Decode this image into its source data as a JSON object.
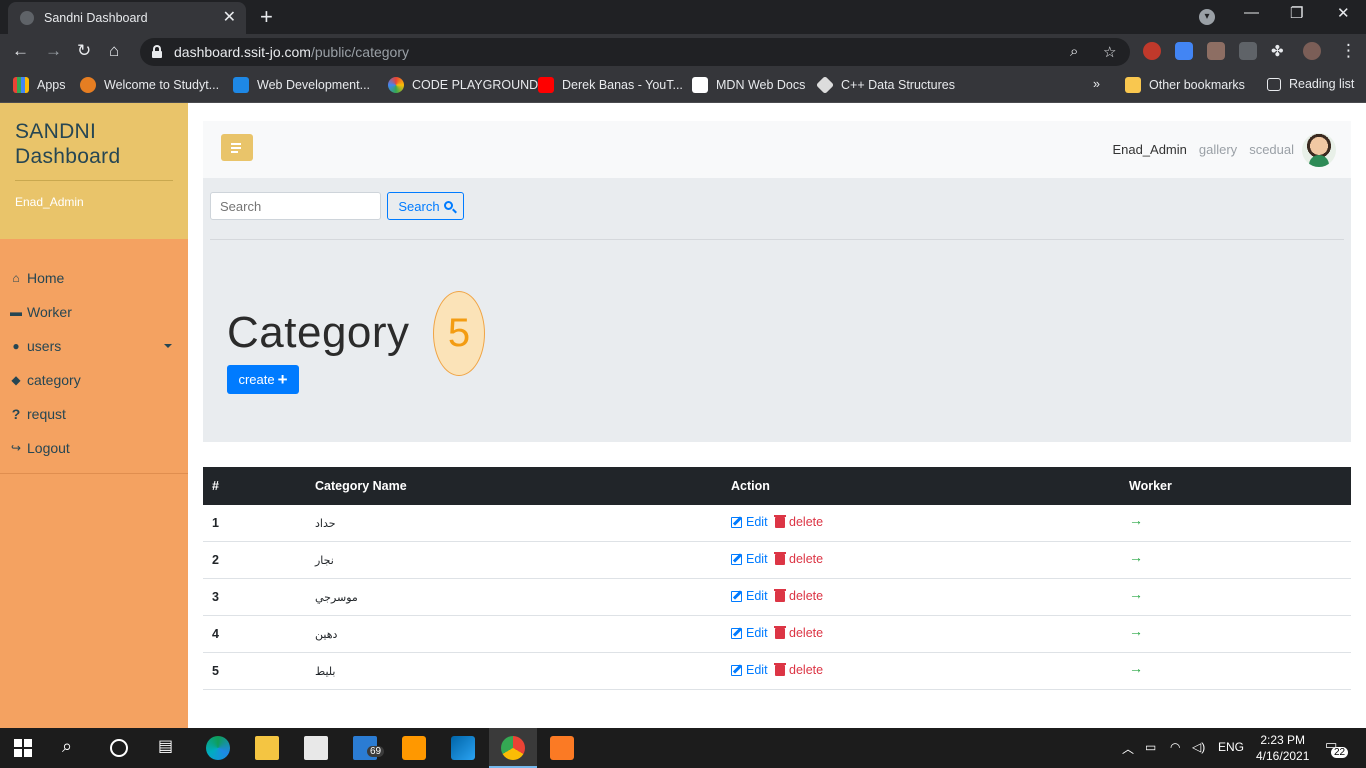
{
  "browser": {
    "tab_title": "Sandni Dashboard",
    "url_domain": "dashboard.ssit-jo.com",
    "url_path": "/public/category",
    "bookmarks": [
      "Apps",
      "Welcome to Studyt...",
      "Web Development...",
      "CODE PLAYGROUND",
      "Derek Banas - YouT...",
      "MDN Web Docs",
      "C++ Data Structures"
    ],
    "bookmarks_overflow": "»",
    "other_bookmarks": "Other bookmarks",
    "reading_list": "Reading list"
  },
  "sidebar": {
    "brand": "SANDNI Dashboard",
    "user": "Enad_Admin",
    "items": [
      {
        "label": "Home",
        "icon": "home-icon",
        "glyph": "⌂"
      },
      {
        "label": "Worker",
        "icon": "briefcase-icon",
        "glyph": "▬"
      },
      {
        "label": "users",
        "icon": "users-icon",
        "glyph": "●"
      },
      {
        "label": "category",
        "icon": "tags-icon",
        "glyph": "◆"
      },
      {
        "label": "requst",
        "icon": "question-icon",
        "glyph": "?"
      },
      {
        "label": "Logout",
        "icon": "logout-icon",
        "glyph": "↪"
      }
    ]
  },
  "topnav": {
    "links": [
      "Enad_Admin",
      "gallery",
      "scedual"
    ]
  },
  "search": {
    "placeholder": "Search",
    "button_label": "Search"
  },
  "page": {
    "title": "Category",
    "count": "5",
    "create_label": "create"
  },
  "table": {
    "headers": [
      "#",
      "Category Name",
      "Action",
      "Worker"
    ],
    "edit_label": "Edit",
    "delete_label": "delete",
    "rows": [
      {
        "id": "1",
        "name": "حداد"
      },
      {
        "id": "2",
        "name": "نجار"
      },
      {
        "id": "3",
        "name": "موسرجي"
      },
      {
        "id": "4",
        "name": "دهين"
      },
      {
        "id": "5",
        "name": "بليط"
      }
    ]
  },
  "taskbar": {
    "mail_badge": "69",
    "language": "ENG",
    "time": "2:23 PM",
    "date": "4/16/2021",
    "notifications": "22"
  },
  "colors": {
    "brand_yellow": "#e9c46a",
    "sidebar_orange": "#f4a261",
    "primary": "#007bff",
    "danger": "#dc3545",
    "success": "#28a745"
  }
}
